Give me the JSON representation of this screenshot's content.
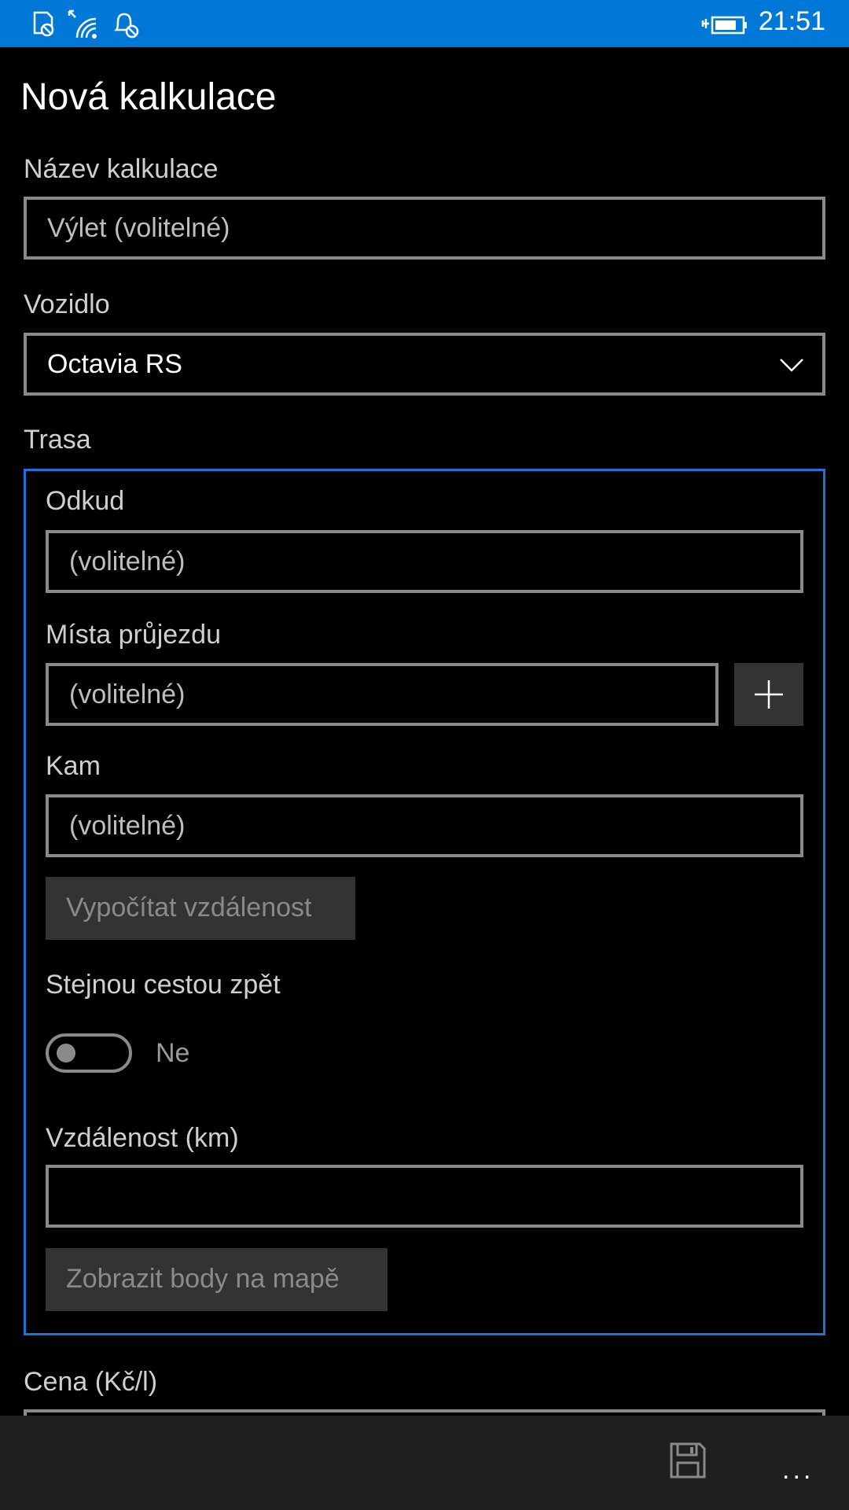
{
  "status_bar": {
    "time": "21:51",
    "icons": [
      "sim-icon",
      "wifi-icon",
      "notifications-icon",
      "battery-charging-icon"
    ],
    "accent_color": "#0078d7"
  },
  "page": {
    "title": "Nová kalkulace"
  },
  "form": {
    "name_label": "Název kalkulace",
    "name_placeholder": "Výlet (volitelné)",
    "vehicle_label": "Vozidlo",
    "vehicle_value": "Octavia RS",
    "route_label": "Trasa",
    "route": {
      "from_label": "Odkud",
      "from_placeholder": "(volitelné)",
      "via_label": "Místa průjezdu",
      "via_placeholder": "(volitelné)",
      "to_label": "Kam",
      "to_placeholder": "(volitelné)",
      "calc_button": "Vypočítat vzdálenost",
      "roundtrip_label": "Stejnou cestou zpět",
      "roundtrip_state": "Ne",
      "distance_label": "Vzdálenost (km)",
      "distance_value": "",
      "map_button": "Zobrazit body na mapě"
    },
    "price_label": "Cena (Kč/l)"
  },
  "app_bar": {
    "icons": [
      "save-icon",
      "more-icon"
    ],
    "more_label": "..."
  }
}
